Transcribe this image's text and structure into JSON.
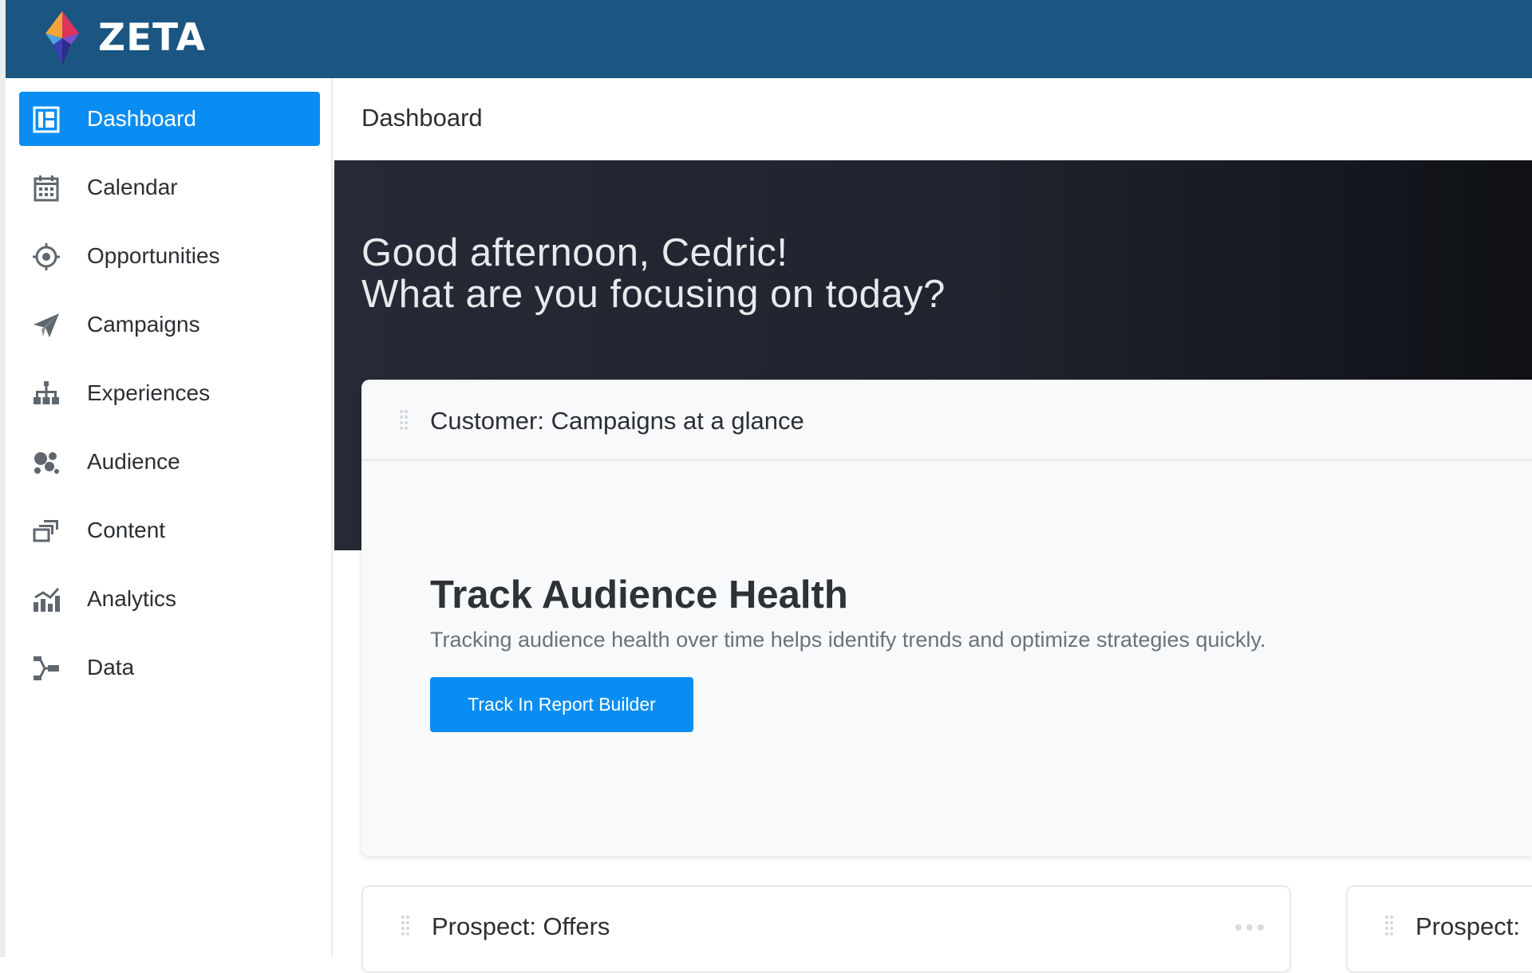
{
  "app": {
    "brand": "ZETA"
  },
  "sidebar": {
    "items": [
      {
        "label": "Dashboard",
        "icon": "dashboard-icon",
        "active": true
      },
      {
        "label": "Calendar",
        "icon": "calendar-icon",
        "active": false
      },
      {
        "label": "Opportunities",
        "icon": "target-icon",
        "active": false
      },
      {
        "label": "Campaigns",
        "icon": "paper-plane-icon",
        "active": false
      },
      {
        "label": "Experiences",
        "icon": "hierarchy-icon",
        "active": false
      },
      {
        "label": "Audience",
        "icon": "audience-icon",
        "active": false
      },
      {
        "label": "Content",
        "icon": "content-stack-icon",
        "active": false
      },
      {
        "label": "Analytics",
        "icon": "analytics-chart-icon",
        "active": false
      },
      {
        "label": "Data",
        "icon": "data-flow-icon",
        "active": false
      }
    ]
  },
  "header": {
    "title": "Dashboard"
  },
  "hero": {
    "greeting_line1": "Good afternoon, Cedric!",
    "greeting_line2": "What are you focusing on today?"
  },
  "main_card": {
    "title": "Customer: Campaigns at a glance",
    "heading": "Track Audience Health",
    "description": "Tracking audience health over time helps identify trends and optimize strategies quickly.",
    "button_label": "Track In Report Builder"
  },
  "lower_cards": [
    {
      "title": "Prospect: Offers"
    },
    {
      "title": "Prospect:"
    }
  ],
  "colors": {
    "topbar": "#1b5682",
    "accent": "#0a8df2",
    "hero_dark": "#1f232d"
  }
}
